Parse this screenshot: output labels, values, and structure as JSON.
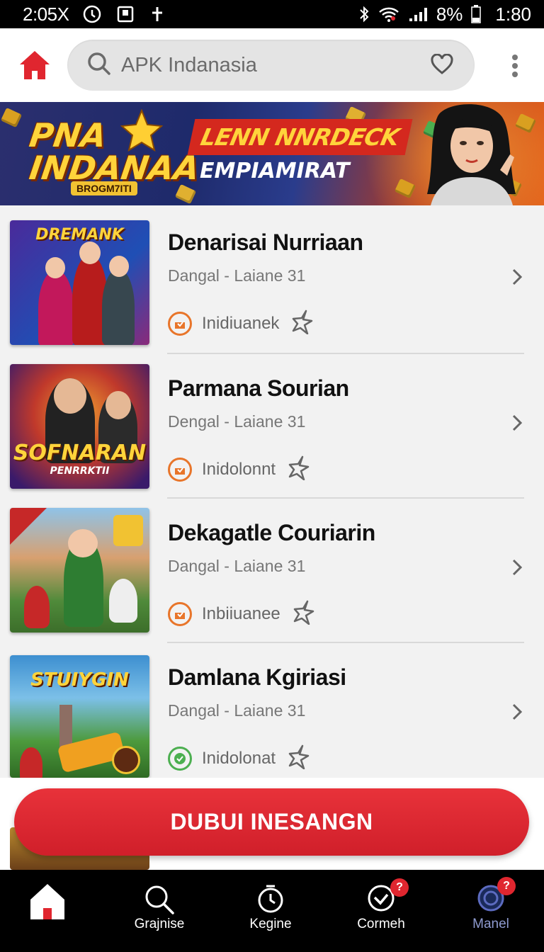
{
  "status_bar": {
    "time": "2:05X",
    "battery": "8%",
    "clock_right": "1:80"
  },
  "header": {
    "search_placeholder": "APK Indanasia"
  },
  "banner": {
    "logo_line1": "PNA",
    "logo_line2": "INDANAA",
    "logo_sub": "BROGM7ITI",
    "promo_line1": "LENN NNRDECK",
    "promo_line2": "EMPIAMIRAT"
  },
  "items": [
    {
      "title": "Denarisai Nurriaan",
      "subtitle": "Dangal - Laiane  31",
      "badge": "Inidiuanek",
      "thumb_title": "DREMANK",
      "thumb_tag": "",
      "badge_color": "#e8752a"
    },
    {
      "title": "Parmana Sourian",
      "subtitle": "Dengal - Laiane  31",
      "badge": "Inidolonnt",
      "thumb_title": "SOFNARAN",
      "thumb_tag": "PENRRKTII",
      "badge_color": "#e8752a"
    },
    {
      "title": "Dekagatle Couriarin",
      "subtitle": "Dangal - Laiane  31",
      "badge": "Inbiiuanee",
      "thumb_title": "",
      "thumb_tag": "",
      "badge_color": "#e8752a"
    },
    {
      "title": "Damlana Kgiriasi",
      "subtitle": "Dangal - Laiane  31",
      "badge": "Inidolonat",
      "thumb_title": "STUIYGIN",
      "thumb_tag": "",
      "badge_color": "#4caf50"
    }
  ],
  "cta": {
    "label": "DUBUI INESANGN"
  },
  "bottom_nav": [
    {
      "label": "",
      "icon": "home-icon"
    },
    {
      "label": "Grajnise",
      "icon": "search-icon"
    },
    {
      "label": "Kegine",
      "icon": "timer-icon"
    },
    {
      "label": "Cormeh",
      "icon": "check-circle-icon",
      "badge": "?"
    },
    {
      "label": "Manel",
      "icon": "profile-icon",
      "badge": "?"
    }
  ],
  "colors": {
    "accent": "#e0262f",
    "badge_orange": "#e8752a",
    "badge_green": "#4caf50"
  }
}
